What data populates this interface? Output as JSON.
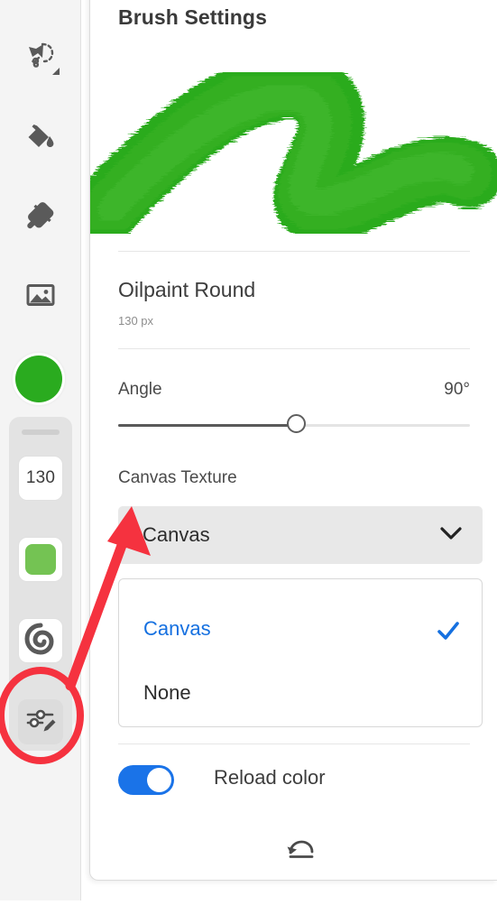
{
  "app": {
    "accent_blue": "#1a73e8",
    "annotation_red": "#f5323f",
    "foreground_color": "#2aab1f",
    "swatch_color": "#74c353"
  },
  "toolbar": {
    "items": [
      {
        "name": "lasso-select-tool",
        "label": "Lasso Select",
        "icon": "lasso-icon",
        "has_dropdown": true
      },
      {
        "name": "paint-bucket-tool",
        "label": "Paint Bucket",
        "icon": "paint-bucket-icon",
        "has_dropdown": false
      },
      {
        "name": "eyedropper-tool",
        "label": "Eyedropper",
        "icon": "eyedropper-icon",
        "has_dropdown": false
      },
      {
        "name": "image-tool",
        "label": "Image",
        "icon": "image-icon",
        "has_dropdown": false
      }
    ],
    "color_circle": {
      "name": "foreground-color",
      "label": "Foreground Color",
      "value": "#2aab1f"
    },
    "dock": {
      "brush_size": {
        "label": "Brush Size",
        "value": "130"
      },
      "color_swatch": {
        "label": "Color Swatch",
        "value": "#74c353"
      },
      "smudge": {
        "label": "Smudge",
        "icon": "spiral-icon"
      },
      "brush_settings": {
        "label": "Brush Settings",
        "icon": "brush-settings-icon",
        "active": true
      }
    }
  },
  "panel": {
    "title": "Brush Settings",
    "preview_alt": "green oil paint brush stroke",
    "brush_name": "Oilpaint Round",
    "brush_size": "130 px",
    "angle": {
      "label": "Angle",
      "value": "90°",
      "percent": 50
    },
    "canvas_texture": {
      "label": "Canvas Texture",
      "selected": "Canvas",
      "options": [
        {
          "label": "Canvas",
          "checked": true
        },
        {
          "label": "None",
          "checked": false
        }
      ]
    },
    "reload_color": {
      "label": "Reload color",
      "enabled": true
    },
    "undo": {
      "label": "Undo",
      "icon": "undo-icon"
    }
  },
  "annotation": {
    "circle_target": "brush-settings-icon",
    "arrow_target": "canvas-texture-select",
    "color": "#f5323f"
  }
}
